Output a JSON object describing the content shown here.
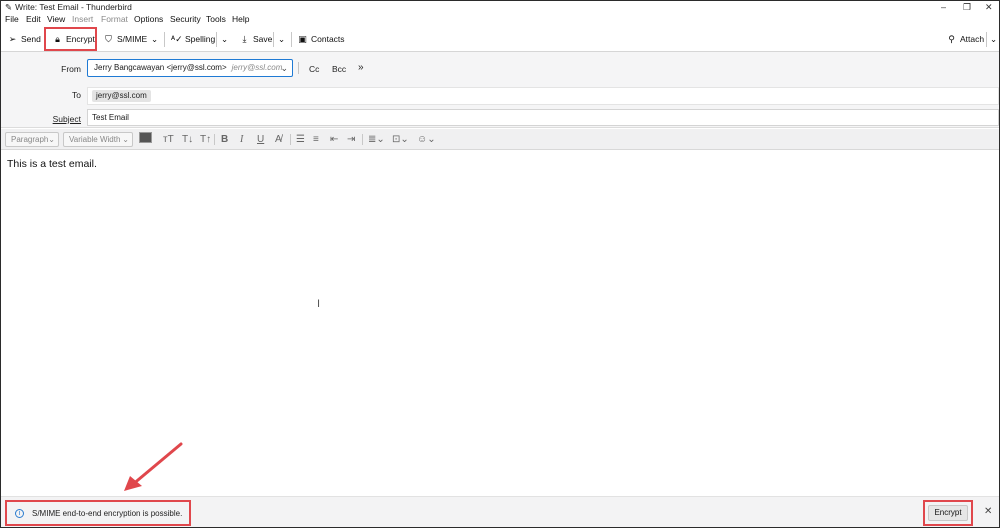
{
  "window": {
    "title": "Write: Test Email - Thunderbird",
    "minimize": "–",
    "restore": "❐",
    "close": "✕"
  },
  "menu": [
    "File",
    "Edit",
    "View",
    "Insert",
    "Format",
    "Options",
    "Security",
    "Tools",
    "Help"
  ],
  "toolbar": {
    "send": "Send",
    "encrypt": "Encrypt",
    "smime": "S/MIME",
    "spelling": "Spelling",
    "save": "Save",
    "contacts": "Contacts",
    "attach": "Attach"
  },
  "header": {
    "from_label": "From",
    "from_name": "Jerry Bangcawayan <jerry@ssl.com>",
    "from_identity": "jerry@ssl.com",
    "cc": "Cc",
    "bcc": "Bcc",
    "more": "»",
    "to_label": "To",
    "to_recipient": "jerry@ssl.com",
    "subject_label": "Subject",
    "subject_value": "Test Email"
  },
  "format": {
    "paragraph": "Paragraph",
    "font": "Variable Width"
  },
  "body": {
    "text": "This is a test email."
  },
  "notification": {
    "message": "S/MIME end-to-end encryption is possible.",
    "button": "Encrypt",
    "close": "✕"
  },
  "colors": {
    "highlight": "#e0474c",
    "focus": "#1f7ad4",
    "info": "#2a7ccf"
  }
}
